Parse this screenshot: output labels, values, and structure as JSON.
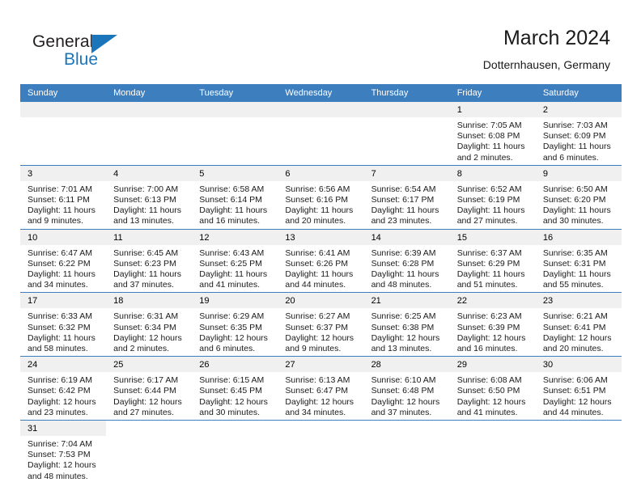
{
  "brand": {
    "name_top": "General",
    "name_bottom": "Blue",
    "accent_color": "#1b75bb"
  },
  "header": {
    "title": "March 2024",
    "subtitle": "Dotternhausen, Germany",
    "header_bg": "#3d7ebf",
    "daynum_bg": "#f0f0f0"
  },
  "weekdays": [
    "Sunday",
    "Monday",
    "Tuesday",
    "Wednesday",
    "Thursday",
    "Friday",
    "Saturday"
  ],
  "labels": {
    "sunrise": "Sunrise:",
    "sunset": "Sunset:",
    "daylight": "Daylight:"
  },
  "weeks": [
    [
      {
        "day": "",
        "empty": true
      },
      {
        "day": "",
        "empty": true
      },
      {
        "day": "",
        "empty": true
      },
      {
        "day": "",
        "empty": true
      },
      {
        "day": "",
        "empty": true
      },
      {
        "day": "1",
        "sunrise": "Sunrise: 7:05 AM",
        "sunset": "Sunset: 6:08 PM",
        "daylight1": "Daylight: 11 hours",
        "daylight2": "and 2 minutes."
      },
      {
        "day": "2",
        "sunrise": "Sunrise: 7:03 AM",
        "sunset": "Sunset: 6:09 PM",
        "daylight1": "Daylight: 11 hours",
        "daylight2": "and 6 minutes."
      }
    ],
    [
      {
        "day": "3",
        "sunrise": "Sunrise: 7:01 AM",
        "sunset": "Sunset: 6:11 PM",
        "daylight1": "Daylight: 11 hours",
        "daylight2": "and 9 minutes."
      },
      {
        "day": "4",
        "sunrise": "Sunrise: 7:00 AM",
        "sunset": "Sunset: 6:13 PM",
        "daylight1": "Daylight: 11 hours",
        "daylight2": "and 13 minutes."
      },
      {
        "day": "5",
        "sunrise": "Sunrise: 6:58 AM",
        "sunset": "Sunset: 6:14 PM",
        "daylight1": "Daylight: 11 hours",
        "daylight2": "and 16 minutes."
      },
      {
        "day": "6",
        "sunrise": "Sunrise: 6:56 AM",
        "sunset": "Sunset: 6:16 PM",
        "daylight1": "Daylight: 11 hours",
        "daylight2": "and 20 minutes."
      },
      {
        "day": "7",
        "sunrise": "Sunrise: 6:54 AM",
        "sunset": "Sunset: 6:17 PM",
        "daylight1": "Daylight: 11 hours",
        "daylight2": "and 23 minutes."
      },
      {
        "day": "8",
        "sunrise": "Sunrise: 6:52 AM",
        "sunset": "Sunset: 6:19 PM",
        "daylight1": "Daylight: 11 hours",
        "daylight2": "and 27 minutes."
      },
      {
        "day": "9",
        "sunrise": "Sunrise: 6:50 AM",
        "sunset": "Sunset: 6:20 PM",
        "daylight1": "Daylight: 11 hours",
        "daylight2": "and 30 minutes."
      }
    ],
    [
      {
        "day": "10",
        "sunrise": "Sunrise: 6:47 AM",
        "sunset": "Sunset: 6:22 PM",
        "daylight1": "Daylight: 11 hours",
        "daylight2": "and 34 minutes."
      },
      {
        "day": "11",
        "sunrise": "Sunrise: 6:45 AM",
        "sunset": "Sunset: 6:23 PM",
        "daylight1": "Daylight: 11 hours",
        "daylight2": "and 37 minutes."
      },
      {
        "day": "12",
        "sunrise": "Sunrise: 6:43 AM",
        "sunset": "Sunset: 6:25 PM",
        "daylight1": "Daylight: 11 hours",
        "daylight2": "and 41 minutes."
      },
      {
        "day": "13",
        "sunrise": "Sunrise: 6:41 AM",
        "sunset": "Sunset: 6:26 PM",
        "daylight1": "Daylight: 11 hours",
        "daylight2": "and 44 minutes."
      },
      {
        "day": "14",
        "sunrise": "Sunrise: 6:39 AM",
        "sunset": "Sunset: 6:28 PM",
        "daylight1": "Daylight: 11 hours",
        "daylight2": "and 48 minutes."
      },
      {
        "day": "15",
        "sunrise": "Sunrise: 6:37 AM",
        "sunset": "Sunset: 6:29 PM",
        "daylight1": "Daylight: 11 hours",
        "daylight2": "and 51 minutes."
      },
      {
        "day": "16",
        "sunrise": "Sunrise: 6:35 AM",
        "sunset": "Sunset: 6:31 PM",
        "daylight1": "Daylight: 11 hours",
        "daylight2": "and 55 minutes."
      }
    ],
    [
      {
        "day": "17",
        "sunrise": "Sunrise: 6:33 AM",
        "sunset": "Sunset: 6:32 PM",
        "daylight1": "Daylight: 11 hours",
        "daylight2": "and 58 minutes."
      },
      {
        "day": "18",
        "sunrise": "Sunrise: 6:31 AM",
        "sunset": "Sunset: 6:34 PM",
        "daylight1": "Daylight: 12 hours",
        "daylight2": "and 2 minutes."
      },
      {
        "day": "19",
        "sunrise": "Sunrise: 6:29 AM",
        "sunset": "Sunset: 6:35 PM",
        "daylight1": "Daylight: 12 hours",
        "daylight2": "and 6 minutes."
      },
      {
        "day": "20",
        "sunrise": "Sunrise: 6:27 AM",
        "sunset": "Sunset: 6:37 PM",
        "daylight1": "Daylight: 12 hours",
        "daylight2": "and 9 minutes."
      },
      {
        "day": "21",
        "sunrise": "Sunrise: 6:25 AM",
        "sunset": "Sunset: 6:38 PM",
        "daylight1": "Daylight: 12 hours",
        "daylight2": "and 13 minutes."
      },
      {
        "day": "22",
        "sunrise": "Sunrise: 6:23 AM",
        "sunset": "Sunset: 6:39 PM",
        "daylight1": "Daylight: 12 hours",
        "daylight2": "and 16 minutes."
      },
      {
        "day": "23",
        "sunrise": "Sunrise: 6:21 AM",
        "sunset": "Sunset: 6:41 PM",
        "daylight1": "Daylight: 12 hours",
        "daylight2": "and 20 minutes."
      }
    ],
    [
      {
        "day": "24",
        "sunrise": "Sunrise: 6:19 AM",
        "sunset": "Sunset: 6:42 PM",
        "daylight1": "Daylight: 12 hours",
        "daylight2": "and 23 minutes."
      },
      {
        "day": "25",
        "sunrise": "Sunrise: 6:17 AM",
        "sunset": "Sunset: 6:44 PM",
        "daylight1": "Daylight: 12 hours",
        "daylight2": "and 27 minutes."
      },
      {
        "day": "26",
        "sunrise": "Sunrise: 6:15 AM",
        "sunset": "Sunset: 6:45 PM",
        "daylight1": "Daylight: 12 hours",
        "daylight2": "and 30 minutes."
      },
      {
        "day": "27",
        "sunrise": "Sunrise: 6:13 AM",
        "sunset": "Sunset: 6:47 PM",
        "daylight1": "Daylight: 12 hours",
        "daylight2": "and 34 minutes."
      },
      {
        "day": "28",
        "sunrise": "Sunrise: 6:10 AM",
        "sunset": "Sunset: 6:48 PM",
        "daylight1": "Daylight: 12 hours",
        "daylight2": "and 37 minutes."
      },
      {
        "day": "29",
        "sunrise": "Sunrise: 6:08 AM",
        "sunset": "Sunset: 6:50 PM",
        "daylight1": "Daylight: 12 hours",
        "daylight2": "and 41 minutes."
      },
      {
        "day": "30",
        "sunrise": "Sunrise: 6:06 AM",
        "sunset": "Sunset: 6:51 PM",
        "daylight1": "Daylight: 12 hours",
        "daylight2": "and 44 minutes."
      }
    ],
    [
      {
        "day": "31",
        "sunrise": "Sunrise: 7:04 AM",
        "sunset": "Sunset: 7:53 PM",
        "daylight1": "Daylight: 12 hours",
        "daylight2": "and 48 minutes."
      },
      {
        "day": "",
        "blank": true
      },
      {
        "day": "",
        "blank": true
      },
      {
        "day": "",
        "blank": true
      },
      {
        "day": "",
        "blank": true
      },
      {
        "day": "",
        "blank": true
      },
      {
        "day": "",
        "blank": true
      }
    ]
  ]
}
